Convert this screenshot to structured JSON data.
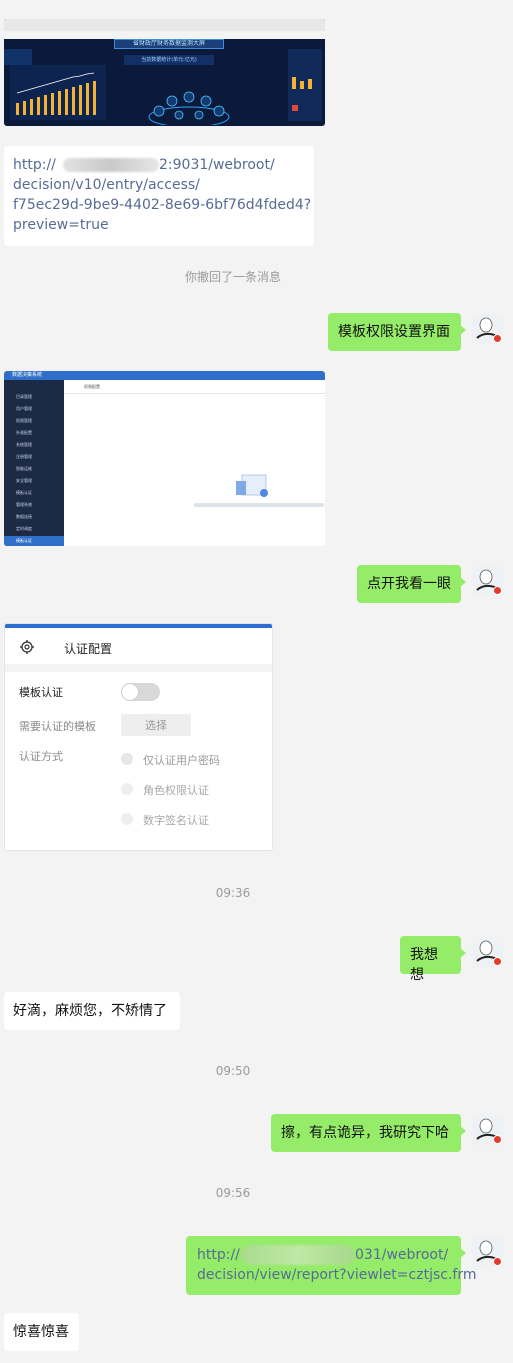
{
  "messages": {
    "link1": {
      "prefix": "http://",
      "rest_line1": "2:9031/webroot/",
      "rest_lines": "decision/v10/entry/access/\nf75ec29d-9be9-4402-8e69-6bf76d4fded4?\npreview=true"
    },
    "recall_note": "你撤回了一条消息",
    "msg_template_perm": "模板权限设置界面",
    "msg_open_look": "点开我看一眼",
    "time1": "09:36",
    "msg_think": "我想想",
    "msg_ok": "好滴，麻烦您，不矫情了",
    "time2": "09:50",
    "msg_weird": "擦，有点诡异，我研究下哈",
    "time3": "09:56",
    "link2": {
      "prefix": "http://",
      "rest_line1": "031/webroot/",
      "line2": "decision/view/report?viewlet=cztjsc.frm"
    },
    "msg_surprise": "惊喜惊喜"
  },
  "dashboard_thumb": {
    "title": "省财政厅财务数据监测大屏",
    "subtitle": "当前数据统计(单元:亿元)"
  },
  "auth_card": {
    "title": "认证配置",
    "template_auth_label": "模板认证",
    "need_auth_label": "需要认证的模板",
    "select_button": "选择",
    "auth_method_label": "认证方式",
    "options": [
      "仅认证用户密码",
      "角色权限认证",
      "数字签名认证"
    ],
    "accent": "#2c6fd0"
  },
  "admin_thumb": {
    "header_text": "数据决策系统",
    "tab_text": "权限配置",
    "menu": [
      "目录管理",
      "用户管理",
      "权限管理",
      "外观配置",
      "系统管理",
      "注册管理",
      "智能运维",
      "安全管理",
      "模板认证",
      "管理系统",
      "数据连接",
      "定时调度",
      "模板认证"
    ]
  }
}
